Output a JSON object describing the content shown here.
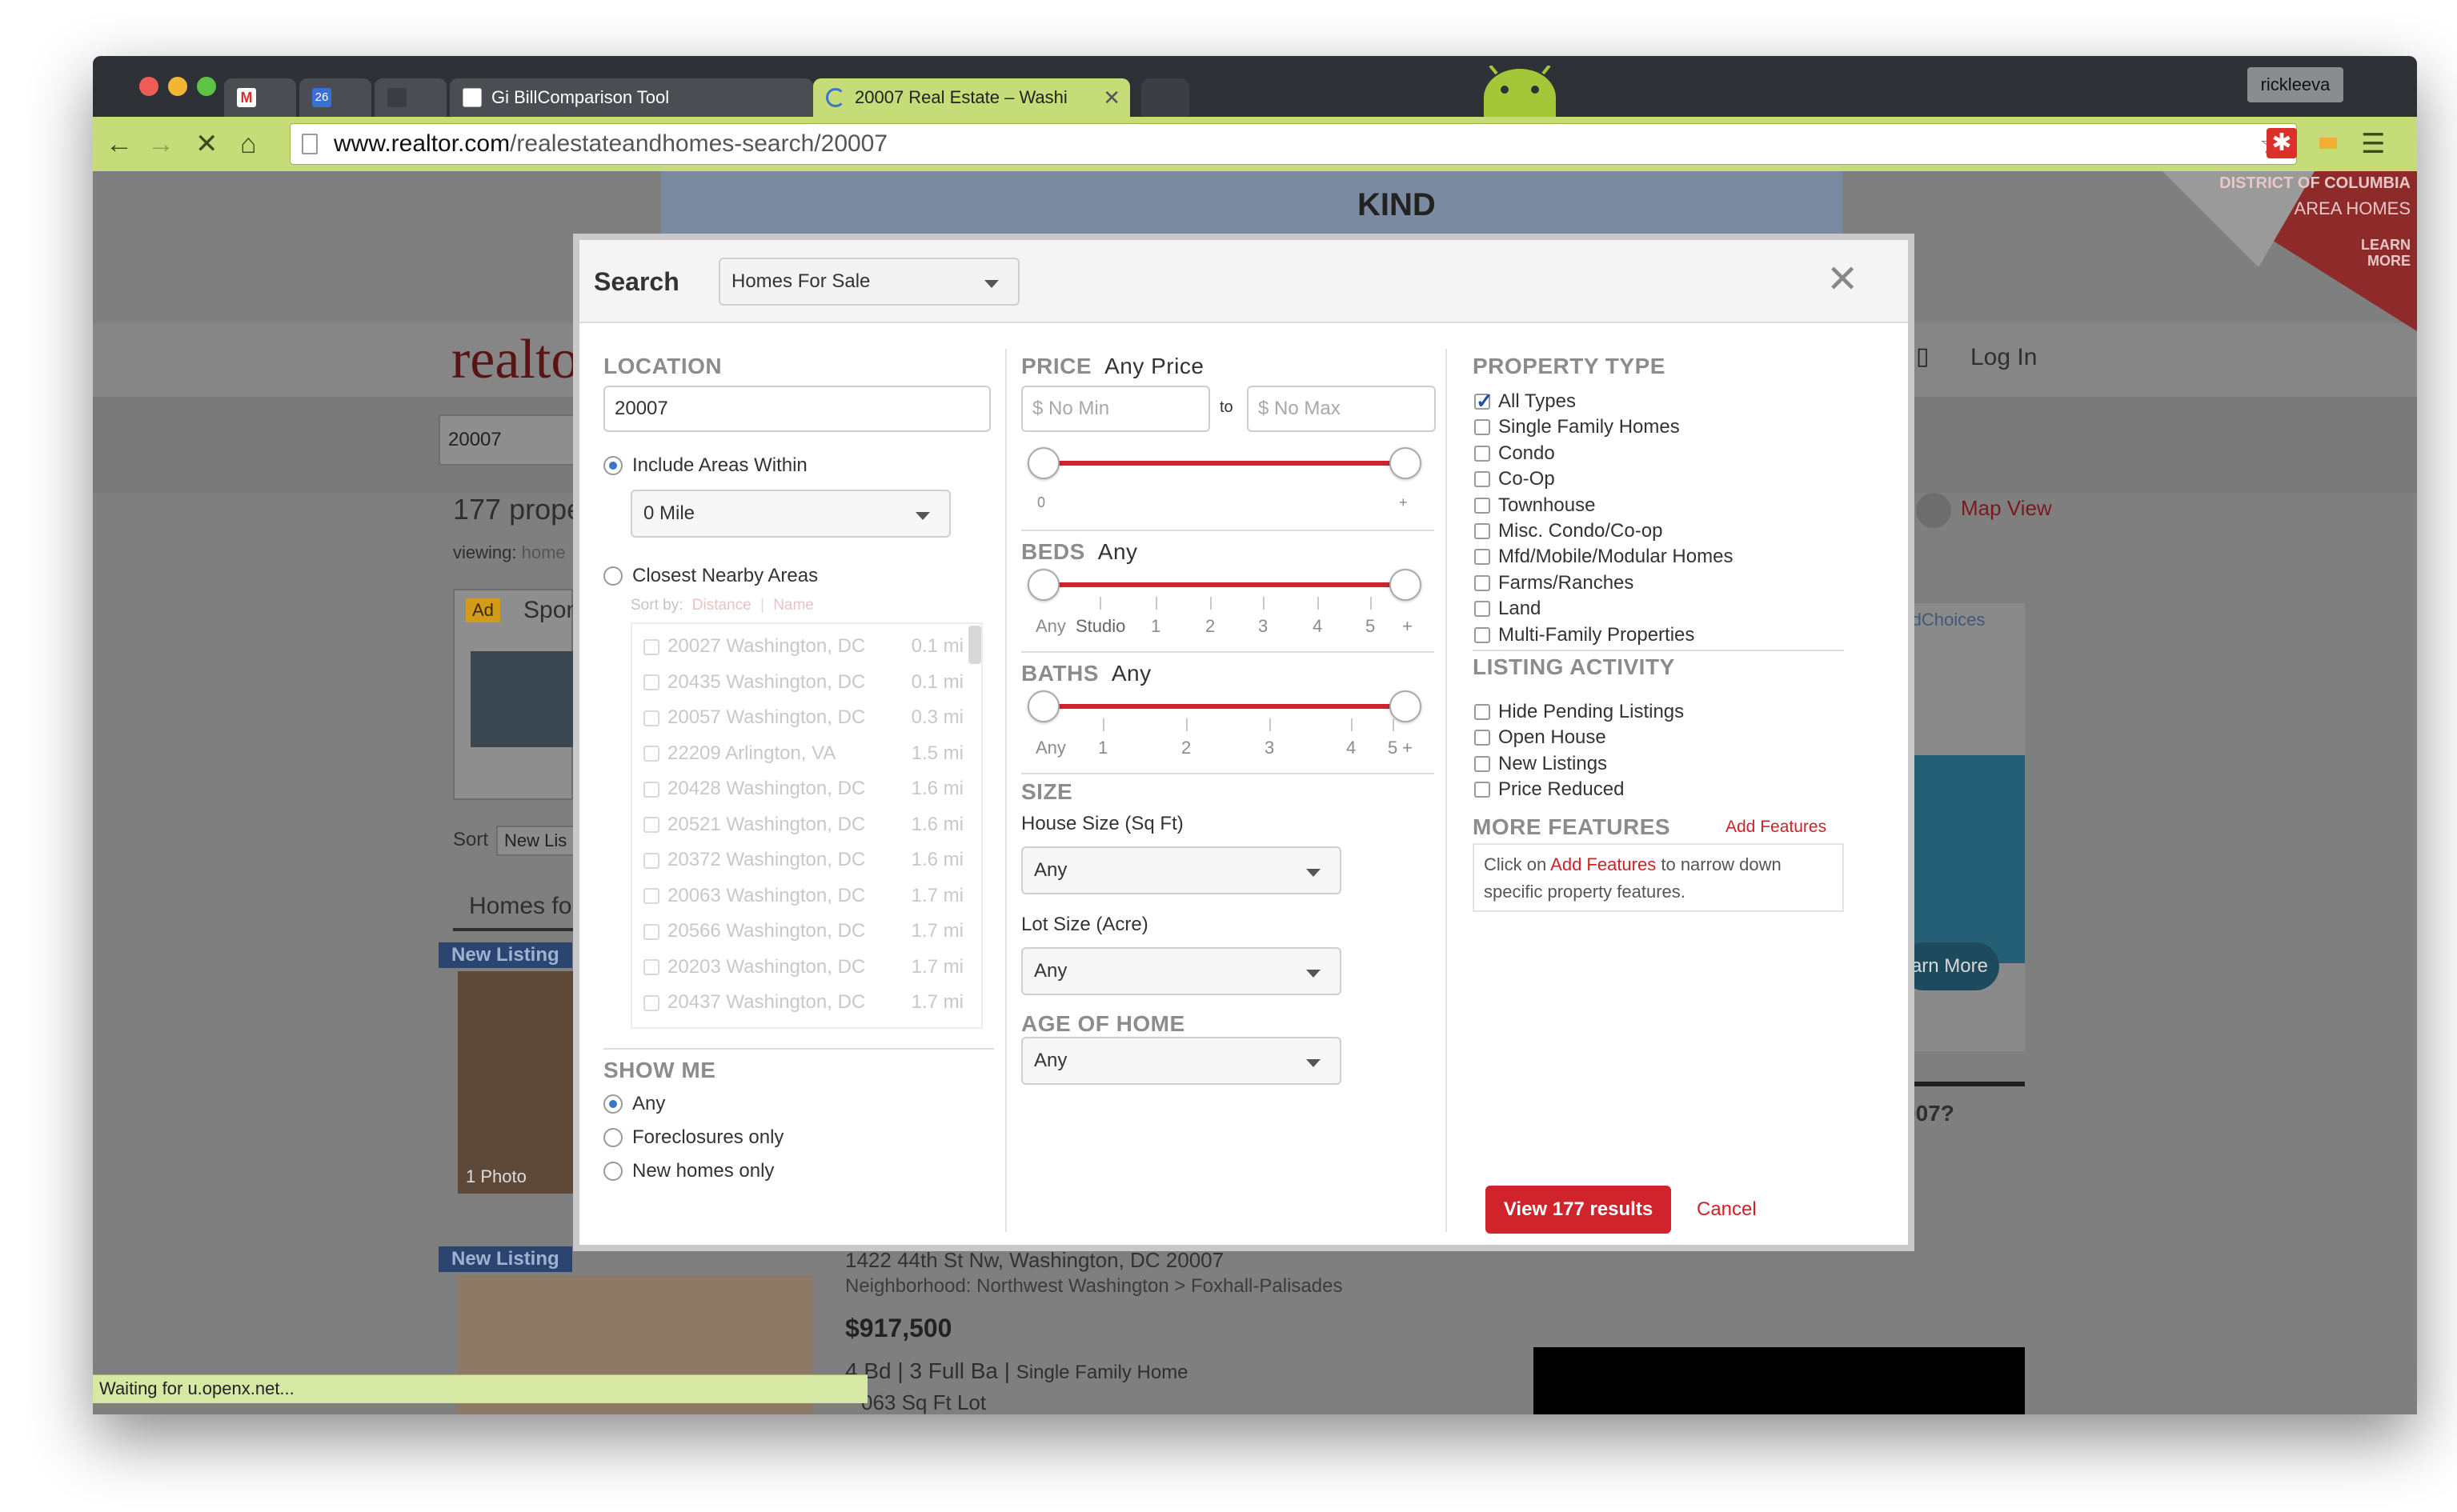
{
  "browser": {
    "tabs": [
      {
        "label": "",
        "icon": "gmail-icon"
      },
      {
        "label": "",
        "icon": "calendar-icon",
        "badge": "26"
      },
      {
        "label": "",
        "icon": "blank-tab-icon"
      },
      {
        "label": "Gi BillComparison Tool",
        "icon": "document-icon"
      },
      {
        "label": "20007 Real Estate – Washi",
        "icon": "loading-spinner-icon"
      }
    ],
    "user": "rickleeva",
    "url_domain": "www.realtor.com",
    "url_path": "/realestateandhomes-search/20007",
    "status": "Waiting for u.openx.net..."
  },
  "background": {
    "logo": "realto",
    "login": "Log In",
    "search_value": "20007",
    "count_text": "177 prope",
    "viewing": "viewing:",
    "viewing_val": "home",
    "ad_badge": "Ad",
    "sponsored": "Spon",
    "sort": "Sort",
    "sort_value": "New Lis",
    "homes_for": "Homes fo",
    "new_listing_1": "New Listing",
    "new_listing_2": "New Listing",
    "photo_count": "1 Photo",
    "map_view": "Map View",
    "adchoices": "AdChoices",
    "learn_more": "arn More",
    "q_text": "007?",
    "banner_district": "DISTRICT OF COLUMBIA",
    "banner_area": "AREA HOMES",
    "banner_learn": "LEARN",
    "banner_more": "MORE",
    "ad_kind": "KIND",
    "listing_address": "1422 44th St Nw, Washington, DC 20007",
    "listing_neighborhood": "Neighborhood: Northwest Washington > Foxhall-Palisades",
    "listing_price": "$917,500",
    "listing_beds": "4 Bd",
    "listing_baths": "3 Full Ba",
    "listing_type": "Single Family Home",
    "listing_sqft": "063 Sq Ft Lot"
  },
  "modal": {
    "title": "Search",
    "search_type": "Homes For Sale",
    "location": {
      "heading": "LOCATION",
      "value": "20007",
      "include_areas": "Include Areas Within",
      "radius": "0 Mile",
      "closest": "Closest Nearby Areas",
      "sort_by": "Sort by:",
      "sort_distance": "Distance",
      "sort_name": "Name",
      "areas": [
        {
          "name": "20027 Washington, DC",
          "dist": "0.1 mi"
        },
        {
          "name": "20435 Washington, DC",
          "dist": "0.1 mi"
        },
        {
          "name": "20057 Washington, DC",
          "dist": "0.3 mi"
        },
        {
          "name": "22209 Arlington, VA",
          "dist": "1.5 mi"
        },
        {
          "name": "20428 Washington, DC",
          "dist": "1.6 mi"
        },
        {
          "name": "20521 Washington, DC",
          "dist": "1.6 mi"
        },
        {
          "name": "20372 Washington, DC",
          "dist": "1.6 mi"
        },
        {
          "name": "20063 Washington, DC",
          "dist": "1.7 mi"
        },
        {
          "name": "20566 Washington, DC",
          "dist": "1.7 mi"
        },
        {
          "name": "20203 Washington, DC",
          "dist": "1.7 mi"
        },
        {
          "name": "20437 Washington, DC",
          "dist": "1.7 mi"
        }
      ]
    },
    "show_me": {
      "heading": "SHOW ME",
      "options": [
        "Any",
        "Foreclosures only",
        "New homes only"
      ],
      "selected": "Any"
    },
    "price": {
      "heading": "PRICE",
      "value": "Any Price",
      "min_placeholder": "$ No Min",
      "to": "to",
      "max_placeholder": "$ No Max",
      "tick_min": "0",
      "tick_max": "+"
    },
    "beds": {
      "heading": "BEDS",
      "value": "Any",
      "ticks": [
        "Any",
        "Studio",
        "1",
        "2",
        "3",
        "4",
        "5",
        "+"
      ]
    },
    "baths": {
      "heading": "BATHS",
      "value": "Any",
      "ticks": [
        "Any",
        "1",
        "2",
        "3",
        "4",
        "5",
        "+"
      ]
    },
    "size": {
      "heading": "SIZE",
      "house_label": "House Size (Sq Ft)",
      "house_value": "Any",
      "lot_label": "Lot Size (Acre)",
      "lot_value": "Any"
    },
    "age": {
      "heading": "AGE OF HOME",
      "value": "Any"
    },
    "property_type": {
      "heading": "PROPERTY TYPE",
      "options": [
        "All Types",
        "Single Family Homes",
        "Condo",
        "Co-Op",
        "Townhouse",
        "Misc. Condo/Co-op",
        "Mfd/Mobile/Modular Homes",
        "Farms/Ranches",
        "Land",
        "Multi-Family Properties"
      ],
      "checked": [
        "All Types"
      ]
    },
    "listing_activity": {
      "heading": "LISTING ACTIVITY",
      "options": [
        "Hide Pending Listings",
        "Open House",
        "New Listings",
        "Price Reduced"
      ]
    },
    "more_features": {
      "heading": "MORE FEATURES",
      "add_link": "Add Features",
      "hint_pre": "Click on",
      "hint_link": "Add Features",
      "hint_post": "to narrow down specific property features."
    },
    "view_button": "View 177 results",
    "cancel": "Cancel"
  },
  "colors": {
    "accent_red": "#cf2128",
    "chrome_green": "#c5dc79",
    "radio_blue": "#3a77c8"
  }
}
